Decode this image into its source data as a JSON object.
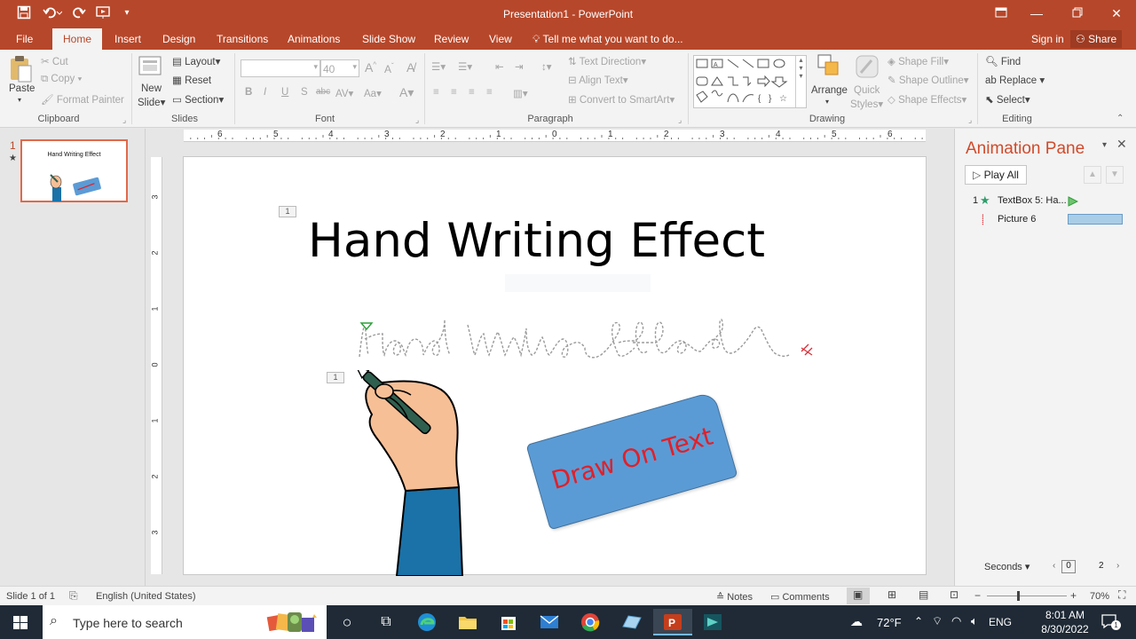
{
  "titlebar": {
    "title": "Presentation1 - PowerPoint",
    "qat": [
      "save-icon",
      "undo-icon",
      "redo-icon",
      "start-from-beginning-icon",
      "customize-qat-icon"
    ]
  },
  "tabs": [
    "File",
    "Home",
    "Insert",
    "Design",
    "Transitions",
    "Animations",
    "Slide Show",
    "Review",
    "View"
  ],
  "active_tab": "Home",
  "tell_me": "Tell me what you want to do...",
  "sign_in": "Sign in",
  "share": "Share",
  "ribbon": {
    "clipboard": {
      "paste": "Paste",
      "cut": "Cut",
      "copy": "Copy",
      "format_painter": "Format Painter",
      "label": "Clipboard"
    },
    "slides": {
      "new_slide": "New",
      "new_slide2": "Slide",
      "layout": "Layout",
      "reset": "Reset",
      "section": "Section",
      "label": "Slides"
    },
    "font": {
      "font_name": "",
      "font_size": "40",
      "bold": "B",
      "italic": "I",
      "underline": "U",
      "shadow": "S",
      "strike": "abc",
      "spacing": "AV",
      "grow": "A",
      "shrink": "A",
      "color": "A",
      "label": "Font"
    },
    "paragraph": {
      "text_direction": "Text Direction",
      "align_text": "Align Text",
      "convert_smartart": "Convert to SmartArt",
      "label": "Paragraph"
    },
    "drawing": {
      "arrange": "Arrange",
      "quick": "Quick",
      "styles": "Styles",
      "shape_fill": "Shape Fill",
      "shape_outline": "Shape Outline",
      "shape_effects": "Shape Effects",
      "label": "Drawing"
    },
    "editing": {
      "find": "Find",
      "replace": "Replace",
      "select": "Select",
      "label": "Editing"
    }
  },
  "thumbnail": {
    "number": "1",
    "star": "★",
    "title": "Hand Writing Effect"
  },
  "slide": {
    "title": "Hand Writing Effect",
    "tag1": "1",
    "tag2": "1",
    "button_text": "Draw On Text",
    "colors": {
      "button": "#5b9bd5",
      "button_text": "#e0202a",
      "sleeve": "#1a72a8",
      "skin": "#f7bf96"
    }
  },
  "ruler": {
    "h_labels": [
      "6",
      "5",
      "4",
      "3",
      "2",
      "1",
      "0",
      "1",
      "2",
      "3",
      "4",
      "5",
      "6"
    ],
    "v_labels": [
      "3",
      "2",
      "1",
      "0",
      "1",
      "2",
      "3"
    ]
  },
  "anim_pane": {
    "title": "Animation Pane",
    "play_all": "Play All",
    "items": [
      {
        "num": "1",
        "name": "TextBox 5: Ha..."
      },
      {
        "num": "",
        "name": "Picture 6"
      }
    ],
    "seconds": "Seconds",
    "timeline_start": "0",
    "timeline_end": "2"
  },
  "status": {
    "slide": "Slide 1 of 1",
    "language": "English (United States)",
    "notes": "Notes",
    "comments": "Comments",
    "zoom": "70%",
    "zoom_level": 0.38
  },
  "taskbar": {
    "search": "Type here to search",
    "weather": "72°F",
    "lang": "ENG",
    "time": "8:01 AM",
    "date": "8/30/2022",
    "notif": "1"
  }
}
